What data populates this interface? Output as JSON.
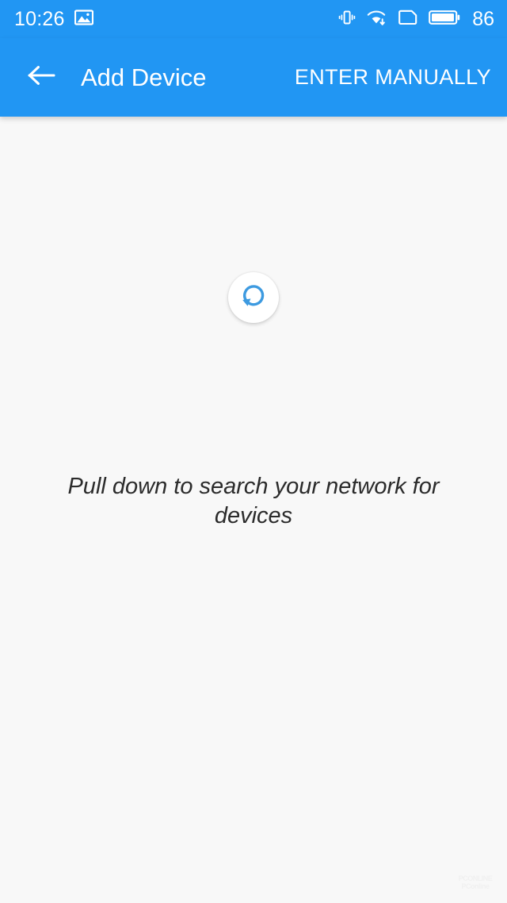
{
  "status_bar": {
    "time": "10:26",
    "battery_percent": "86",
    "icons": [
      {
        "name": "screenshot-image-icon",
        "position": "left"
      },
      {
        "name": "vibrate-icon",
        "position": "right"
      },
      {
        "name": "wifi-download-icon",
        "position": "right"
      },
      {
        "name": "sim-card-icon",
        "position": "right"
      },
      {
        "name": "battery-icon",
        "position": "right"
      }
    ],
    "background_color": "#2196f3",
    "foreground_color": "#ffffff"
  },
  "app_bar": {
    "back_icon": "arrow-left-icon",
    "title": "Add Device",
    "action_label": "ENTER MANUALLY",
    "background_color": "#2196f3",
    "text_color": "#ffffff"
  },
  "main": {
    "refresh_icon": "refresh-circular-arrow-icon",
    "refresh_icon_color": "#3d9ae0",
    "hint_text": "Pull down to search your network for devices",
    "background_color": "#f8f8f8",
    "hint_text_color": "#2b2b2b"
  },
  "watermark": {
    "line1": "PCONLINE",
    "line2": "PConline"
  }
}
